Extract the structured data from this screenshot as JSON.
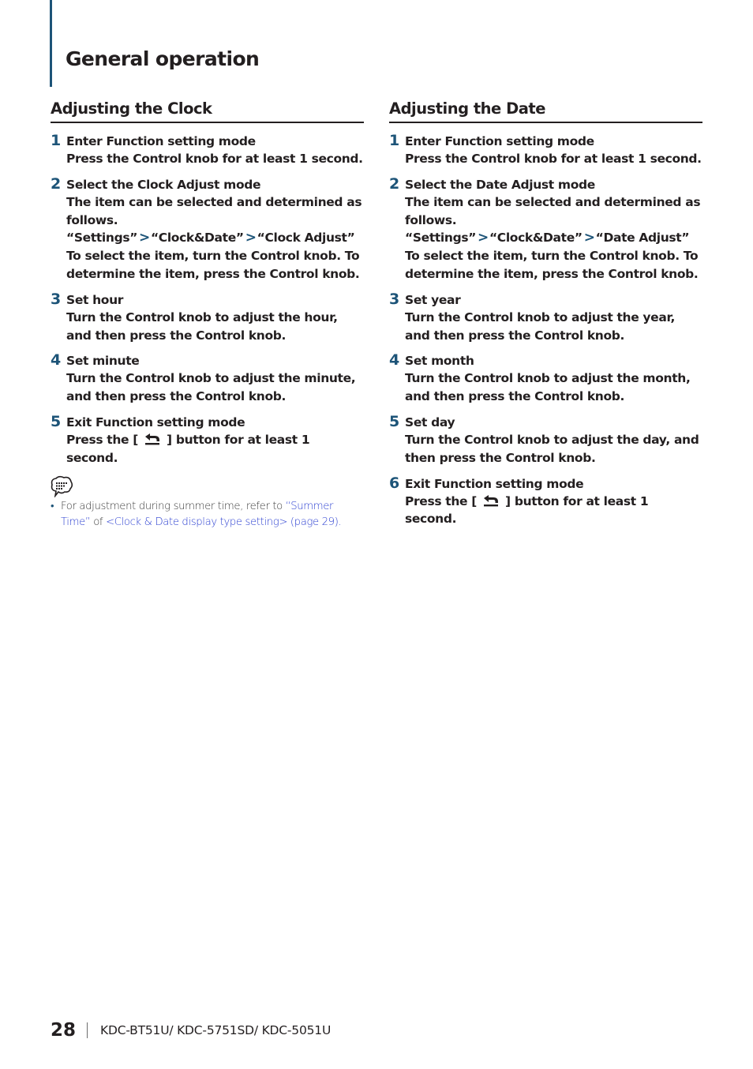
{
  "chapter": {
    "title": "General operation",
    "accent_color": "#1d5478"
  },
  "sections": {
    "clock": {
      "title": "Adjusting the Clock",
      "steps": [
        {
          "num": "1",
          "head": "Enter Function setting mode",
          "body": "Press the Control knob for at least 1 second."
        },
        {
          "num": "2",
          "head": "Select the Clock Adjust mode",
          "body": "The item can be selected and determined as follows.",
          "path": [
            "“Settings”",
            "“Clock&Date”",
            "“Clock Adjust”"
          ],
          "body2": "To select the item, turn the Control knob. To determine the item, press the Control knob."
        },
        {
          "num": "3",
          "head": "Set hour",
          "body": "Turn the Control knob to adjust the hour, and then press the Control knob."
        },
        {
          "num": "4",
          "head": "Set minute",
          "body": "Turn the Control knob to adjust the minute, and then press the Control knob."
        },
        {
          "num": "5",
          "head": "Exit Function setting mode",
          "body_pre": "Press the [",
          "body_icon": "return-arrow-icon",
          "body_post": "] button for at least 1 second."
        }
      ],
      "note": {
        "icon": "note-speech-bubble-icon",
        "bullet": "•",
        "text_pre": "For adjustment during summer time, refer to ",
        "link1": "“Summer Time”",
        "text_mid": " of ",
        "link2": "<Clock & Date display type setting> (page 29)",
        "text_post": ".",
        "link_color": "#2b3fd1"
      }
    },
    "date": {
      "title": "Adjusting the Date",
      "steps": [
        {
          "num": "1",
          "head": "Enter Function setting mode",
          "body": "Press the Control knob for at least 1 second."
        },
        {
          "num": "2",
          "head": "Select the Date Adjust mode",
          "body": "The item can be selected and determined as follows.",
          "path": [
            "“Settings”",
            "“Clock&Date”",
            "“Date Adjust”"
          ],
          "body2": "To select the item, turn the Control knob. To determine the item, press the Control knob."
        },
        {
          "num": "3",
          "head": "Set year",
          "body": "Turn the Control knob to adjust the year, and then press the Control knob."
        },
        {
          "num": "4",
          "head": "Set month",
          "body": "Turn the Control knob to adjust the month, and then press the Control knob."
        },
        {
          "num": "5",
          "head": "Set day",
          "body": "Turn the Control knob to adjust the day, and then press the Control knob."
        },
        {
          "num": "6",
          "head": "Exit Function setting mode",
          "body_pre": "Press the [",
          "body_icon": "return-arrow-icon",
          "body_post": "] button for at least 1 second."
        }
      ]
    }
  },
  "path_separator": ">",
  "footer": {
    "page_number": "28",
    "models": "KDC-BT51U/ KDC-5751SD/ KDC-5051U"
  }
}
